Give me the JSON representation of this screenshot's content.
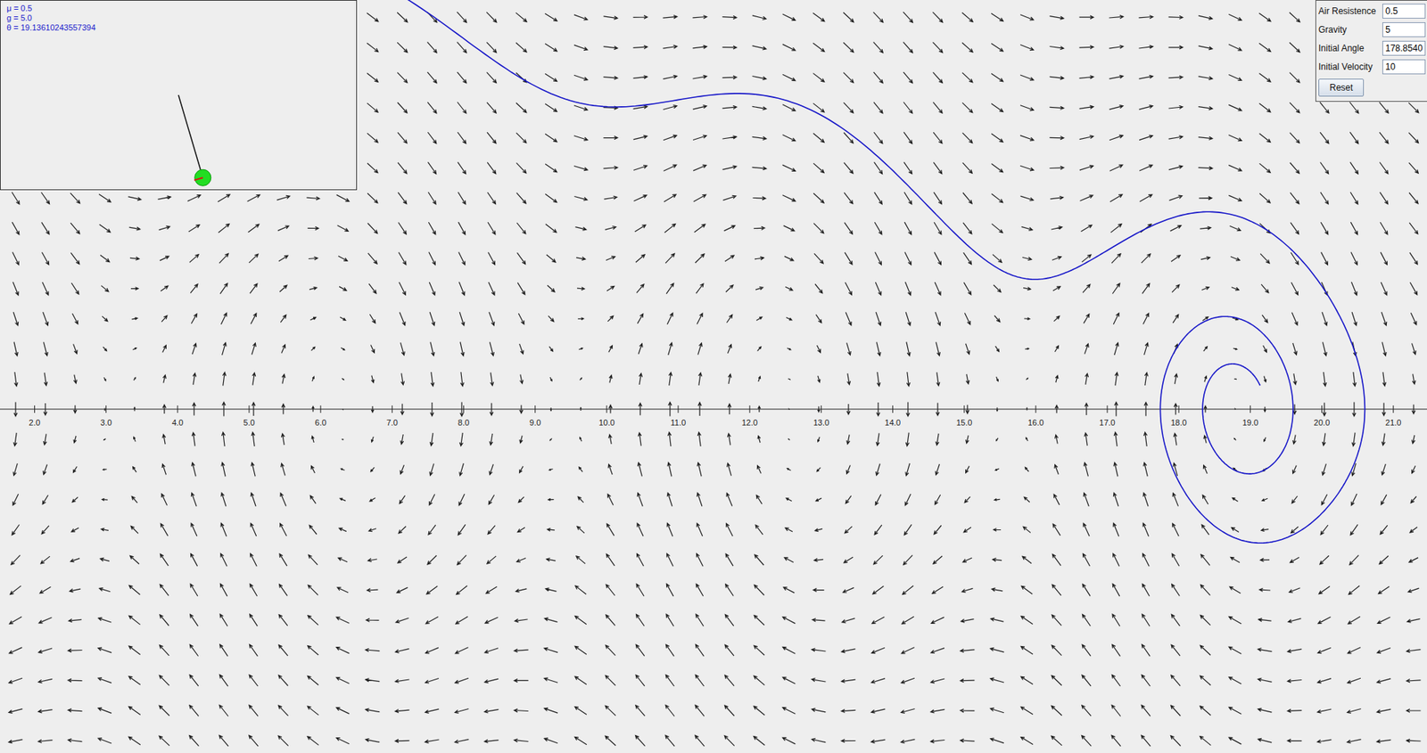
{
  "inset": {
    "lines": [
      "μ = 0.5",
      "g = 5.0",
      "θ = 19.13610243557394"
    ],
    "pendulum": {
      "angle": 19.13610243557394
    }
  },
  "controls": {
    "fields": [
      {
        "label": "Air Resistence",
        "value": "0.5"
      },
      {
        "label": "Gravity",
        "value": "5"
      },
      {
        "label": "Initial Angle",
        "value": "178.8540"
      },
      {
        "label": "Initial Velocity",
        "value": "10"
      }
    ],
    "button": "Reset"
  },
  "simulation": {
    "air_resistance": 0.5,
    "gravity": 5,
    "initial_angle_deg": 178.854,
    "initial_velocity": 10
  },
  "axis": {
    "ticks": [
      {
        "label": "2.0",
        "value": 2
      },
      {
        "label": "3.0",
        "value": 3
      },
      {
        "label": "4.0",
        "value": 4
      },
      {
        "label": "5.0",
        "value": 5
      },
      {
        "label": "6.0",
        "value": 6
      },
      {
        "label": "7.0",
        "value": 7
      },
      {
        "label": "8.0",
        "value": 8
      },
      {
        "label": "9.0",
        "value": 9
      },
      {
        "label": "10.0",
        "value": 10
      },
      {
        "label": "11.0",
        "value": 11
      },
      {
        "label": "12.0",
        "value": 12
      },
      {
        "label": "13.0",
        "value": 13
      },
      {
        "label": "14.0",
        "value": 14
      },
      {
        "label": "15.0",
        "value": 15
      },
      {
        "label": "16.0",
        "value": 16
      },
      {
        "label": "17.0",
        "value": 17
      },
      {
        "label": "18.0",
        "value": 18
      },
      {
        "label": "19.0",
        "value": 19
      },
      {
        "label": "20.0",
        "value": 20
      },
      {
        "label": "21.0",
        "value": 21
      }
    ]
  }
}
